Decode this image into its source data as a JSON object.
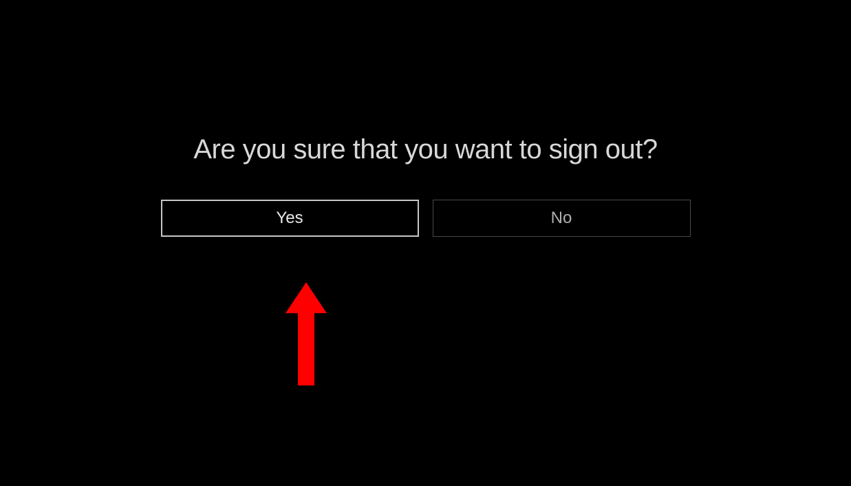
{
  "dialog": {
    "title": "Are you sure that you want to sign out?",
    "confirm_label": "Yes",
    "cancel_label": "No"
  },
  "annotation": {
    "arrow_color": "#ff0000"
  }
}
